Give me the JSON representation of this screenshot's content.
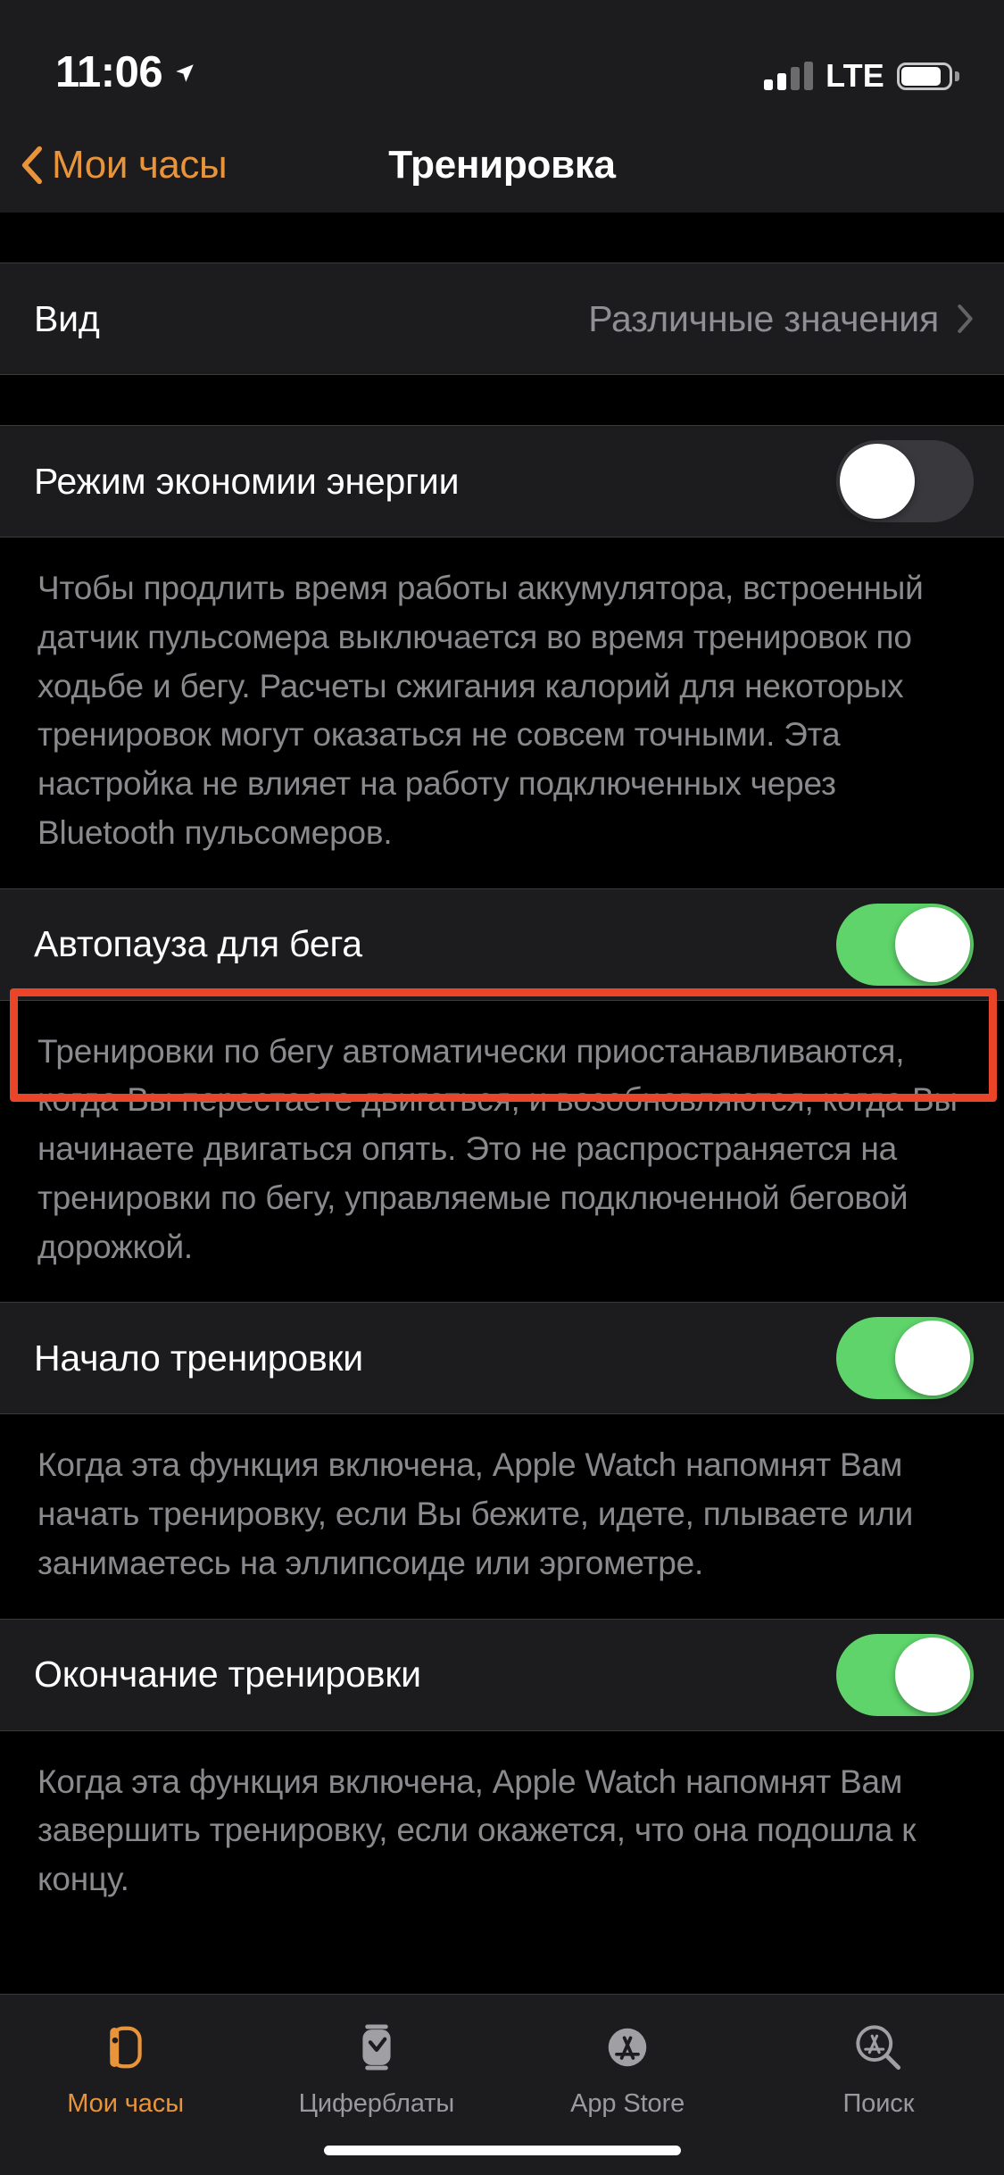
{
  "status_bar": {
    "time": "11:06",
    "location_icon": "location-arrow-icon",
    "signal_icon": "cellular-signal-icon",
    "signal_bars_filled": 2,
    "signal_bars_total": 4,
    "carrier_tech": "LTE",
    "battery_icon": "battery-icon"
  },
  "nav": {
    "back_label": "Мои часы",
    "back_icon": "chevron-left-icon",
    "title": "Тренировка"
  },
  "sections": {
    "view": {
      "label": "Вид",
      "value": "Различные значения",
      "chevron_icon": "chevron-right-icon"
    },
    "power_saving": {
      "label": "Режим экономии энергии",
      "toggle_state": "off",
      "footer": "Чтобы продлить время работы аккумулятора, встроенный датчик пульсомера выключается во время тренировок по ходьбе и бегу. Расчеты сжигания калорий для некоторых тренировок могут оказаться не совсем точными. Эта настройка не влияет на работу подключенных через Bluetooth пульсомеров."
    },
    "auto_pause": {
      "label": "Автопауза для бега",
      "toggle_state": "on",
      "highlighted": true,
      "footer": "Тренировки по бегу автоматически приостанавливаются, когда Вы перестаете двигаться, и возобновляются, когда Вы начинаете двигаться опять. Это не распространяется на тренировки по бегу, управляемые подключенной беговой дорожкой."
    },
    "workout_start": {
      "label": "Начало тренировки",
      "toggle_state": "on",
      "footer": "Когда эта функция включена, Apple Watch напомнят Вам начать тренировку, если Вы бежите, идете, плываете или занимаетесь на эллипсоиде или эргометре."
    },
    "workout_end": {
      "label": "Окончание тренировки",
      "toggle_state": "on",
      "footer": "Когда эта функция включена, Apple Watch напомнят Вам завершить тренировку, если окажется, что она подошла к концу."
    }
  },
  "tab_bar": {
    "items": [
      {
        "label": "Мои часы",
        "icon": "apple-watch-icon",
        "active": true
      },
      {
        "label": "Циферблаты",
        "icon": "watch-face-icon",
        "active": false
      },
      {
        "label": "App Store",
        "icon": "app-store-filled-icon",
        "active": false
      },
      {
        "label": "Поиск",
        "icon": "app-store-search-icon",
        "active": false
      }
    ]
  },
  "colors": {
    "accent": "#e8943a",
    "toggle_on": "#5ed46a",
    "toggle_off": "#39393d",
    "annotation": "#ea4528",
    "group_bg": "#1c1c1e",
    "page_bg": "#000000",
    "secondary_text": "#8e8e93"
  }
}
